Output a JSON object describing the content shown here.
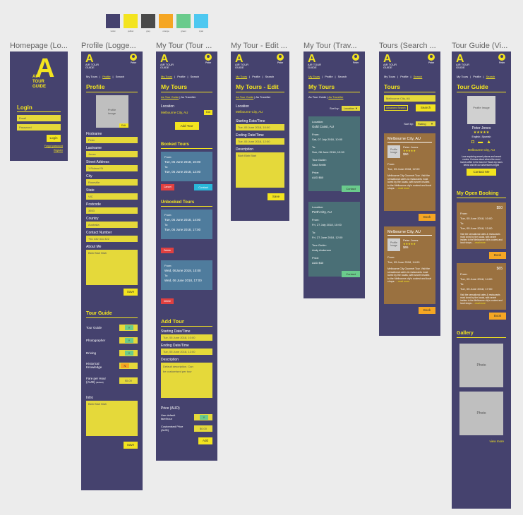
{
  "palette": [
    {
      "color": "#45426e",
      "label": "violet"
    },
    {
      "color": "#f3e41f",
      "label": "yellow"
    },
    {
      "color": "#4a4a4a",
      "label": "grey"
    },
    {
      "color": "#f5a623",
      "label": "orange"
    },
    {
      "color": "#6acb8c",
      "label": "green"
    },
    {
      "color": "#4ec8f0",
      "label": "cyan"
    }
  ],
  "titles": {
    "f1": "Homepage (Lo...",
    "f2": "Profile (Logge...",
    "f3": "My Tour (Tour ...",
    "f4": "My Tour - Edit ...",
    "f5": "My Tour (Trav...",
    "f6": "Tours (Search ...",
    "f7": "Tour Guide (Vi..."
  },
  "logo": {
    "big_letter": "A",
    "big_line1": "AIR",
    "big_line2": "TOUR",
    "big_line3": "GUIDE",
    "small_text": "AIR TOUR GUIDE"
  },
  "user": {
    "name": "Peter"
  },
  "nav": {
    "my_tours": "My Tours",
    "profile": "Profile",
    "search": "Search",
    "sep": "|"
  },
  "home": {
    "login_title": "Login",
    "email_ph": "Email",
    "password_ph": "Password",
    "login_btn": "Login",
    "forgot": "Forgot password",
    "register": "Register"
  },
  "profile": {
    "title": "Profile",
    "image_label": "Profile Image",
    "edit": "Edit",
    "fields": [
      {
        "label": "Firstname",
        "value": "Peter"
      },
      {
        "label": "Lastname",
        "value": "Jones"
      },
      {
        "label": "Street Address",
        "value": "1 Roland St"
      },
      {
        "label": "City",
        "value": "Roseville"
      },
      {
        "label": "State",
        "value": "VIC"
      },
      {
        "label": "Postcode",
        "value": "3653"
      },
      {
        "label": "Country",
        "value": "Australia"
      },
      {
        "label": "Contact Number",
        "value": "+61 432 311 322"
      }
    ],
    "about_label": "About Me",
    "about_value": "Blah Blah Blah",
    "save": "Save",
    "guide_title": "Tour Guide",
    "guide_rows": [
      {
        "label": "Tour Guide",
        "value": "Y",
        "color": "#6acb8c"
      },
      {
        "label": "Photographer",
        "value": "Y",
        "color": "#6acb8c"
      },
      {
        "label": "Driving",
        "value": "Y",
        "color": "#6acb8c"
      },
      {
        "label": "Historical Knowledge",
        "value": "N",
        "color": "#f5a623"
      }
    ],
    "fare_label": "Fare per Hour (AUD)",
    "fare_sub": "(default)",
    "fare_value": "$5.00",
    "intro_label": "Intro",
    "intro_value": "Blah Blah Blah",
    "save2": "Save"
  },
  "mytour": {
    "title": "My Tours",
    "seg_guide": "As Tour Guide",
    "seg_traveller": "As Traveller",
    "location_label": "Location",
    "location_value": "Melbourne City, AU",
    "edit": "Edit",
    "add_tour": "Add Tour",
    "booked_title": "Booked Tours",
    "from_label": "From:",
    "to_label": "To:",
    "booked": {
      "from": "Tue, 05 June 2018, 10:00",
      "to": "Tue, 05 June 2018, 12:00"
    },
    "cancel": "Cancel",
    "contact": "Contact",
    "unbooked_title": "Unbooked Tours",
    "unbooked1": {
      "from": "Tue, 05 June 2018, 14:00",
      "to": "Tue, 05 June 2018, 17:00"
    },
    "unbooked2": {
      "from": "Wed, 06June 2018, 10:00",
      "to": "Wed, 06 June 2018, 17:00"
    },
    "delete": "Delete",
    "add_title": "Add Tour",
    "start_label": "Starting Date/Time",
    "start_value": "Tue, 05 June 2018, 10:00",
    "end_label": "Ending Date/Time",
    "end_value": "Tue, 05 June 2018, 12:00",
    "desc_label": "Description",
    "desc_value": "Default description. Can be customised per tour",
    "price_label": "Price (AUD)",
    "use_default": "Use default fare/hour",
    "use_default_val": "Y",
    "custom_price": "Customised Price (AUD)",
    "custom_price_val": "$0.00",
    "add": "Add"
  },
  "edit": {
    "title": "My Tours - Edit",
    "desc_value": "Blah Blah Blah",
    "save": "Save"
  },
  "trav": {
    "sort_label": "Sort by:",
    "sort_value": "Location",
    "cards": [
      {
        "loc_label": "Location:",
        "loc": "Gold Coast, AU",
        "from": "Sat, 07 July 2018, 10:00",
        "to": "Sun, 08 June 2018, 12:00",
        "guide_label": "Tour Guide:",
        "guide": "Sara Smith",
        "price_label": "Price:",
        "price": "AUD $60",
        "btn": "Contact"
      },
      {
        "loc_label": "Location:",
        "loc": "Perth City, AU",
        "from": "Fri, 27 July 2018, 10:00",
        "to": "Fri, 27 June 2018, 12:00",
        "guide_label": "Tour Guide:",
        "guide": "Andy Anderson",
        "price_label": "Price:",
        "price": "AUD $40",
        "btn": "Contact"
      }
    ]
  },
  "search": {
    "title": "Tours",
    "input": "Melbourne City, AU",
    "advanced": "Advanced Search",
    "btn": "Search",
    "sort_label": "Sort by:",
    "sort_value": "Rating",
    "cards": [
      {
        "city": "Melbourne City, AU",
        "img": "Profile Image",
        "name": "Peter Jones",
        "stars": "★★★★★",
        "price": "$50",
        "date": "Tue, 05 June 2018, 12:00",
        "desc": "Melbourne City Gourmet Tour. Visit the sensational cafes & restaurants most loved by the locals, with secret insides to the Melbourne city's coolest and local shops.. ",
        "more": "...read more",
        "btn": "Book"
      },
      {
        "city": "Melbourne City, AU",
        "img": "Profile Image",
        "name": "Peter Jones",
        "stars": "★★★★★",
        "price": "$65",
        "date": "Tue, 05 June 2018, 14:00",
        "desc": "Melbourne City Gourmet Tour. Visit the sensational cafes & restaurants most loved by the locals, with secret insides to the Melbourne city's coolest and local shops.. ",
        "more": "...read more",
        "btn": "Book"
      }
    ]
  },
  "guide": {
    "title": "Tour Guide",
    "img": "Profile Image",
    "name": "Peter Jones",
    "stars": "★★★★★",
    "langs": "English | Spanish",
    "city": "Melbourne City, AU",
    "desc": "Love exploring secret places and secret routes. Curious about where the most loved coffee in the town is? Book my tours below and let our adventures begin!",
    "contact": "Contact Me",
    "open_title": "My Open Booking",
    "bookings": [
      {
        "price": "$50",
        "from": "Tue, 05 June 2018, 10:00",
        "to": "Tue, 05 June 2018, 12:00",
        "desc": "Visit the sensational cafes & restaurants most loved by the locals, with secret insides to the Melbourne city's coolest and local shops.. ",
        "more": "...read more",
        "btn": "Book"
      },
      {
        "price": "$65",
        "from": "Tue, 05 June 2018, 14:00",
        "to": "Tue, 05 June 2018, 17:00",
        "desc": "Visit the sensational cafes & restaurants most loved by the locals, with secret insides to the Melbourne city's coolest and local shops.. ",
        "more": "...read more",
        "btn": "Book"
      }
    ],
    "gallery_title": "Gallery",
    "photo": "Photo",
    "view_more": "view more"
  }
}
